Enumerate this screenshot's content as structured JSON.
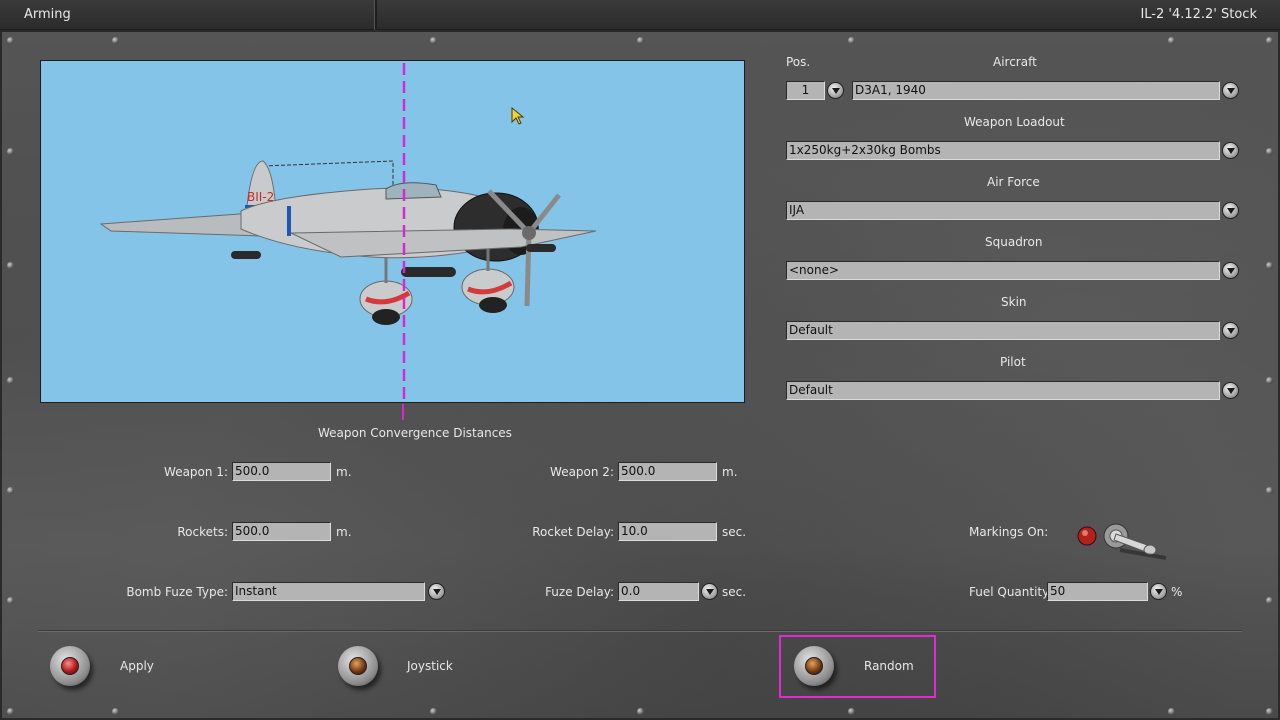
{
  "window": {
    "title": "Arming",
    "version": "IL-2 '4.12.2' Stock"
  },
  "preview": {
    "aircraft_marking": "BII-2",
    "label": "Weapon Convergence Distances"
  },
  "aircraft_form": {
    "pos_label": "Pos.",
    "pos_value": "1",
    "aircraft_label": "Aircraft",
    "aircraft_value": "D3A1, 1940",
    "loadout_label": "Weapon Loadout",
    "loadout_value": "1x250kg+2x30kg Bombs",
    "airforce_label": "Air Force",
    "airforce_value": "IJA",
    "squadron_label": "Squadron",
    "squadron_value": "<none>",
    "skin_label": "Skin",
    "skin_value": "Default",
    "pilot_label": "Pilot",
    "pilot_value": "Default"
  },
  "convergence": {
    "weapon1_label": "Weapon 1:",
    "weapon1_value": "500.0",
    "weapon1_unit": "m.",
    "weapon2_label": "Weapon 2:",
    "weapon2_value": "500.0",
    "weapon2_unit": "m.",
    "rockets_label": "Rockets:",
    "rockets_value": "500.0",
    "rockets_unit": "m.",
    "rocket_delay_label": "Rocket Delay:",
    "rocket_delay_value": "10.0",
    "rocket_delay_unit": "sec.",
    "bomb_fuze_label": "Bomb Fuze Type:",
    "bomb_fuze_value": "Instant",
    "fuze_delay_label": "Fuze Delay:",
    "fuze_delay_value": "0.0",
    "fuze_delay_unit": "sec."
  },
  "options": {
    "markings_label": "Markings On:",
    "markings_on": true,
    "fuel_label": "Fuel Quantity:",
    "fuel_value": "50",
    "fuel_unit": "%"
  },
  "buttons": {
    "apply": "Apply",
    "joystick": "Joystick",
    "random": "Random"
  },
  "colors": {
    "sky": "#84c4e8",
    "focus": "#e02ad8",
    "convergence_line": "#d22bd6"
  }
}
